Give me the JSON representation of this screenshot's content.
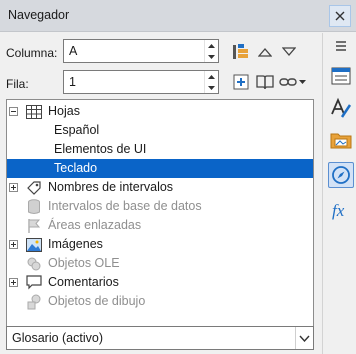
{
  "window": {
    "title": "Navegador"
  },
  "row_fields": [
    {
      "label": "Columna:",
      "value": "A"
    },
    {
      "label": "Fila:",
      "value": "1"
    }
  ],
  "tree": {
    "hojas": {
      "label": "Hojas",
      "children": [
        "Español",
        "Elementos de UI",
        "Teclado"
      ],
      "selected": "Teclado"
    },
    "intervalos": "Nombres de intervalos",
    "bd": "Intervalos de base de datos",
    "areas": "Áreas enlazadas",
    "imagenes": "Imágenes",
    "ole": "Objetos OLE",
    "comentarios": "Comentarios",
    "dibujo": "Objetos de dibujo"
  },
  "document_select": {
    "value": "Glosario (activo)"
  },
  "colors": {
    "selection": "#0a64c8",
    "accent_blue": "#1f6fc5",
    "folder_orange": "#e8a23a"
  }
}
